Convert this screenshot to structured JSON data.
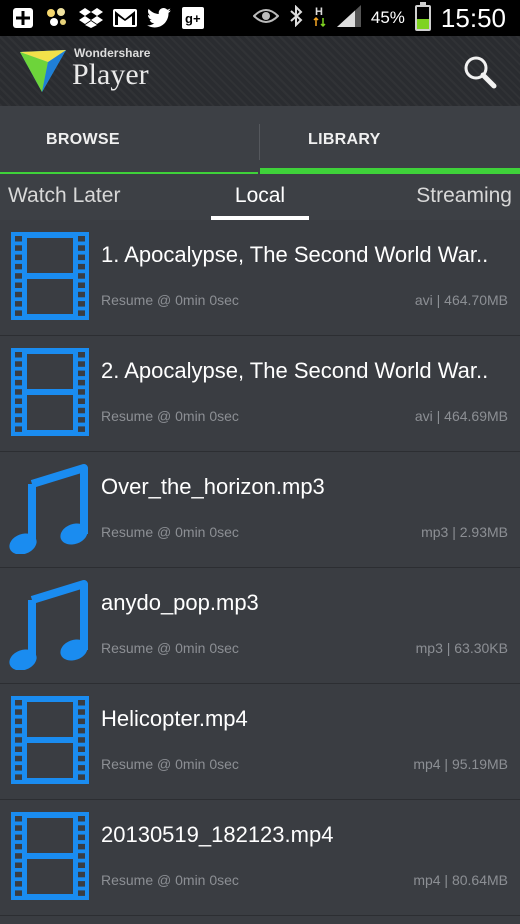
{
  "status_bar": {
    "icons": [
      "add-icon",
      "gallery-icon",
      "dropbox-icon",
      "gmail-icon",
      "twitter-icon",
      "google-plus-icon"
    ],
    "right_icons": [
      "eye-icon",
      "bluetooth-icon",
      "hspa-icon",
      "signal-icon"
    ],
    "battery_percent": "45%",
    "battery_level": 0.45,
    "time": "15:50"
  },
  "header": {
    "brand_small": "Wondershare",
    "brand_name": "Player",
    "search_icon": "search-icon"
  },
  "main_tabs": [
    {
      "label": "BROWSE",
      "selected": false
    },
    {
      "label": "LIBRARY",
      "selected": true
    }
  ],
  "sub_tabs": [
    {
      "label": "Watch Later",
      "selected": false
    },
    {
      "label": "Local",
      "selected": true
    },
    {
      "label": "Streaming",
      "selected": false
    }
  ],
  "colors": {
    "accent_green": "#3fd23a",
    "icon_blue": "#1a8cf0",
    "background": "#3a3d42"
  },
  "items": [
    {
      "icon": "video-file-icon",
      "title": "1. Apocalypse, The Second World War..",
      "resume": "Resume @ 0min  0sec",
      "meta": "avi | 464.70MB"
    },
    {
      "icon": "video-file-icon",
      "title": "2. Apocalypse, The Second World War..",
      "resume": "Resume @ 0min  0sec",
      "meta": "avi | 464.69MB"
    },
    {
      "icon": "music-note-icon",
      "title": "Over_the_horizon.mp3",
      "resume": "Resume @ 0min  0sec",
      "meta": "mp3 | 2.93MB"
    },
    {
      "icon": "music-note-icon",
      "title": "anydo_pop.mp3",
      "resume": "Resume @ 0min  0sec",
      "meta": "mp3 | 63.30KB"
    },
    {
      "icon": "video-file-icon",
      "title": "Helicopter.mp4",
      "resume": "Resume @ 0min  0sec",
      "meta": "mp4 | 95.19MB"
    },
    {
      "icon": "video-file-icon",
      "title": "20130519_182123.mp4",
      "resume": "Resume @ 0min  0sec",
      "meta": "mp4 | 80.64MB"
    }
  ]
}
